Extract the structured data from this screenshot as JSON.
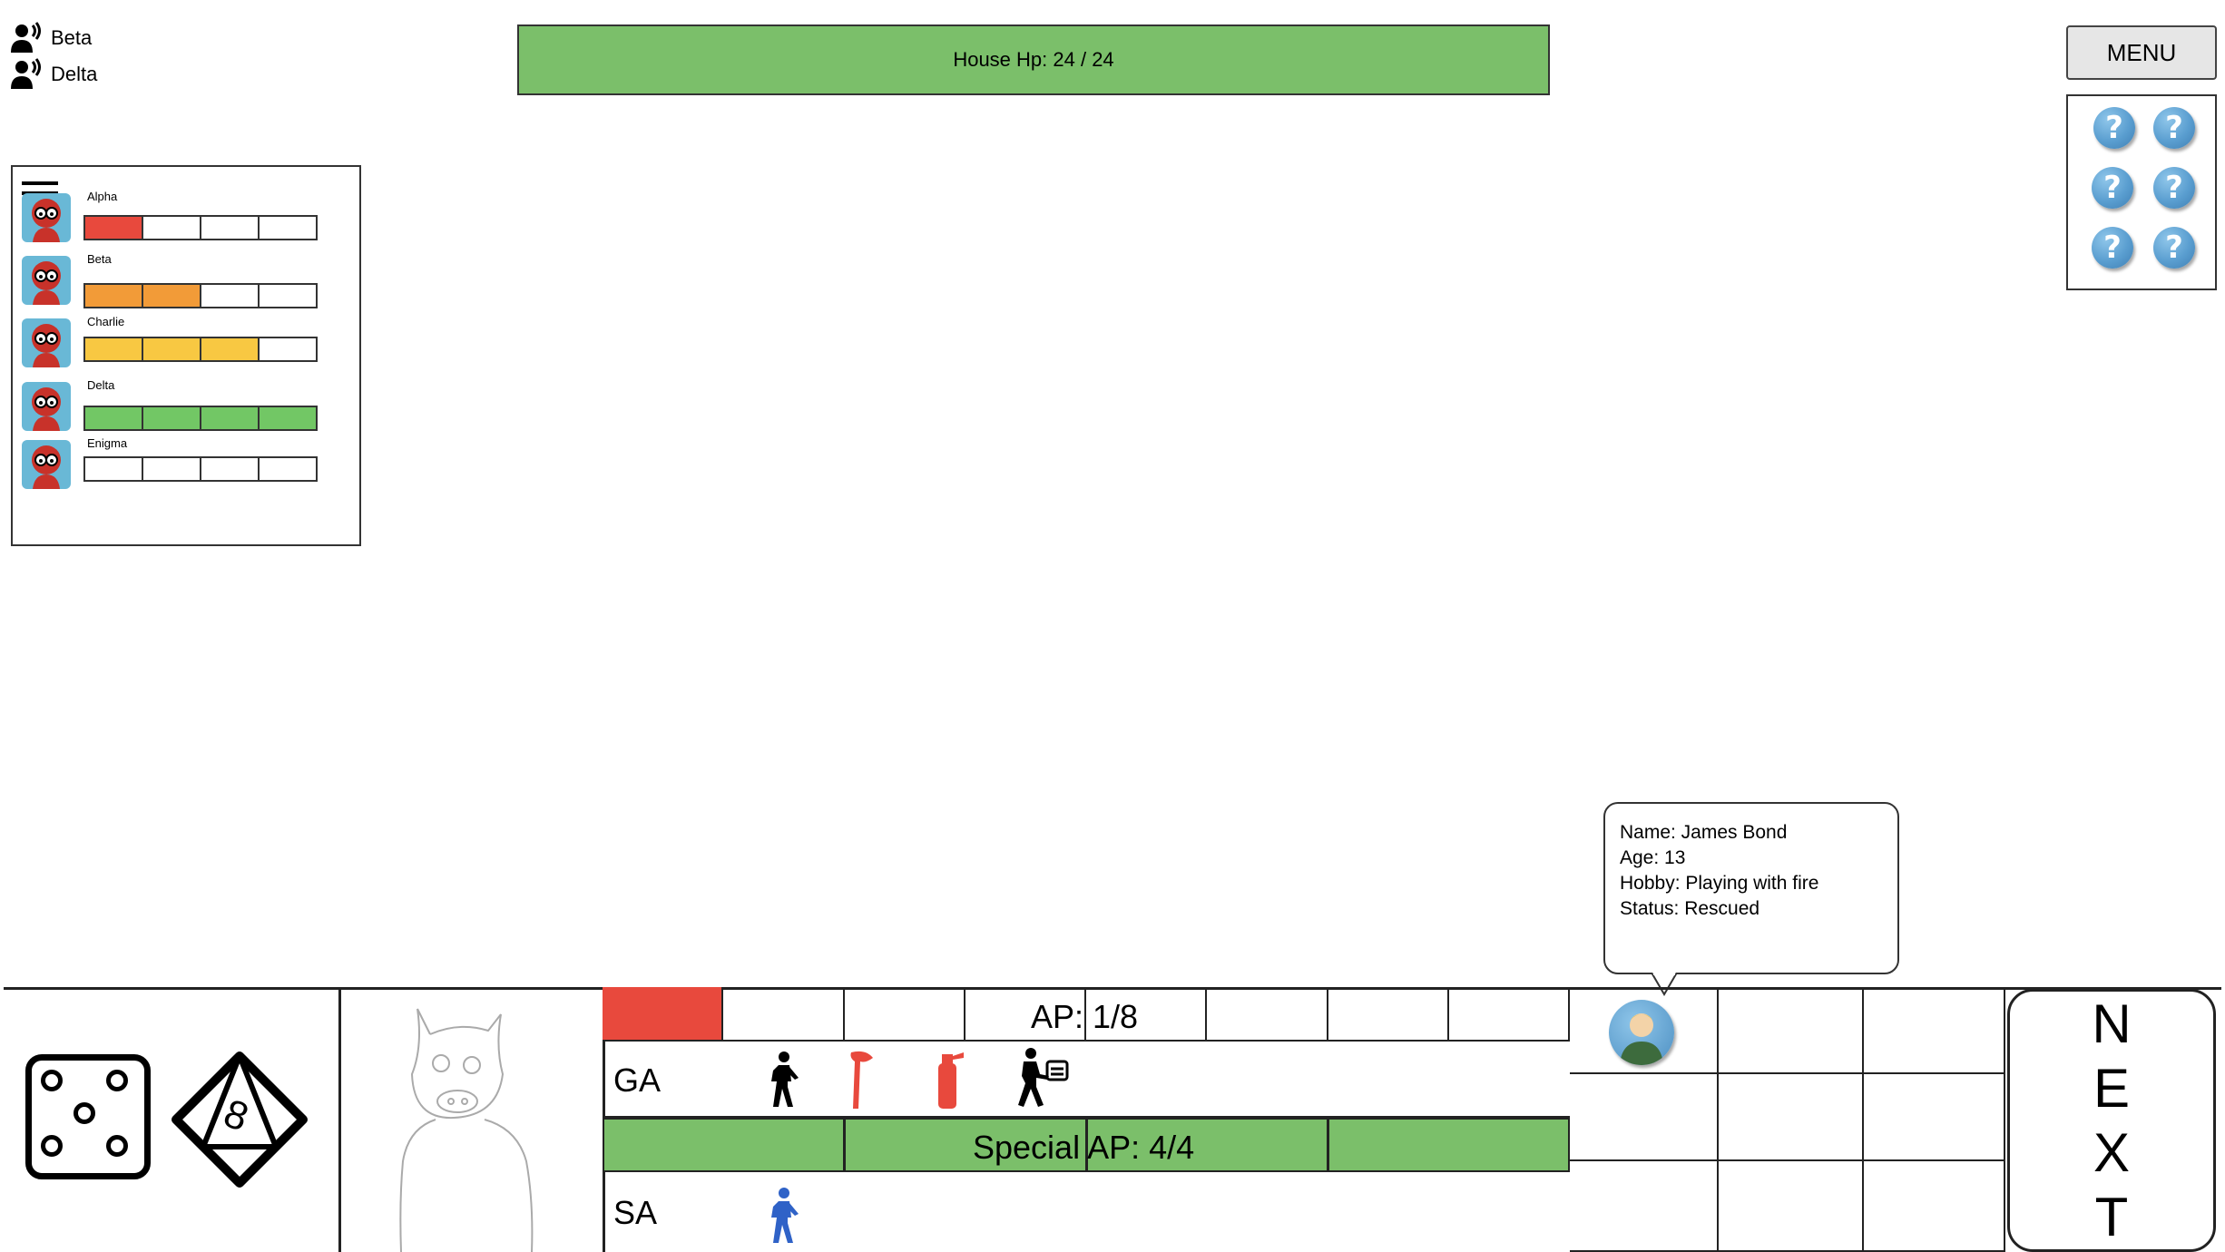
{
  "voice_channel": {
    "users": [
      {
        "name": "Beta",
        "icon": "speaking-user-icon"
      },
      {
        "name": "Delta",
        "icon": "speaking-user-icon"
      }
    ]
  },
  "house": {
    "label": "House Hp: 24 / 24",
    "hp": 24,
    "max_hp": 24,
    "color": "#7bbf6a"
  },
  "menu": {
    "label": "MENU"
  },
  "help_buttons": {
    "glyph": "?",
    "count": 6,
    "icon": "help-icon"
  },
  "players": [
    {
      "name": "Alpha",
      "hp_filled": 1,
      "hp_max": 4,
      "color": "#e8493d"
    },
    {
      "name": "Beta",
      "hp_filled": 2,
      "hp_max": 4,
      "color": "#f29b38"
    },
    {
      "name": "Charlie",
      "hp_filled": 3,
      "hp_max": 4,
      "color": "#f8c842"
    },
    {
      "name": "Delta",
      "hp_filled": 4,
      "hp_max": 4,
      "color": "#72c765"
    },
    {
      "name": "Enigma",
      "hp_filled": 0,
      "hp_max": 4,
      "color": "#ffffff"
    }
  ],
  "victim_tooltip": {
    "name": "Name: James Bond",
    "age": "Age: 13",
    "hobby": "Hobby: Playing with fire",
    "status": "Status: Rescued"
  },
  "action_points": {
    "label": "AP: 1/8",
    "used": 1,
    "total": 8,
    "used_color": "#e8493d"
  },
  "general_actions": {
    "label": "GA",
    "actions": [
      "walk-icon",
      "axe-icon",
      "extinguisher-icon",
      "carry-victim-icon"
    ]
  },
  "special_ap": {
    "label": "Special AP: 4/4",
    "value": 4,
    "total": 4,
    "color": "#7bbf6a"
  },
  "special_actions": {
    "label": "SA",
    "actions": [
      "special-walk-icon"
    ]
  },
  "dice": {
    "d6_icon": "d6-five-icon",
    "d8_icon": "d8-icon",
    "d8_value": "8"
  },
  "next_button": {
    "letters": [
      "N",
      "E",
      "X",
      "T"
    ]
  }
}
